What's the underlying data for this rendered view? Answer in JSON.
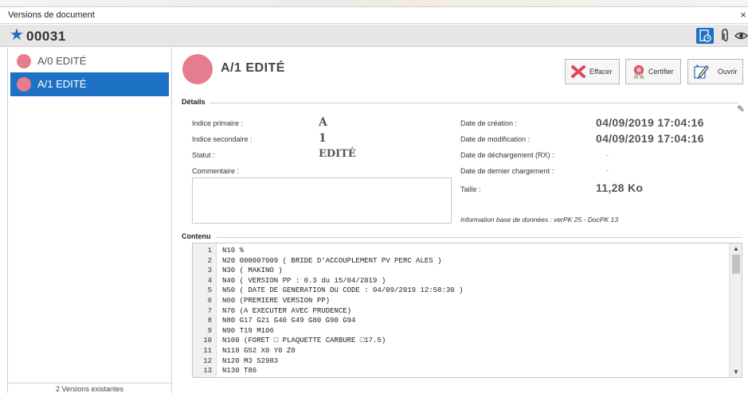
{
  "window": {
    "title": "Versions de document",
    "close_glyph": "×"
  },
  "document": {
    "star_glyph": "★",
    "number": "00031"
  },
  "toolbar": {
    "icons": [
      "history-icon",
      "paperclip-icon",
      "eye-icon"
    ],
    "accent": "#1f6fc5"
  },
  "versions": [
    {
      "label": "A/0  EDITÉ",
      "selected": false,
      "color": "#e47e8f"
    },
    {
      "label": "A/1  EDITÉ",
      "selected": true,
      "color": "#e47e8f"
    }
  ],
  "versions_count": "2 Versions existantes",
  "selected_version": {
    "title": "A/1 EDITÉ",
    "color": "#e47e8f"
  },
  "buttons": {
    "effacer": "Effacer",
    "certifier": "Certifier",
    "ouvrir": "Ouvrir"
  },
  "details": {
    "header": "Détails",
    "indice_primaire_label": "Indice primaire :",
    "indice_primaire_value": "A",
    "indice_secondaire_label": "Indice secondaire :",
    "indice_secondaire_value": "1",
    "statut_label": "Statut :",
    "statut_value": "EDITÉ",
    "commentaire_label": "Commentaire :",
    "date_creation_label": "Date de création :",
    "date_creation_value": "04/09/2019 17:04:16",
    "date_modification_label": "Date de modification :",
    "date_modification_value": "04/09/2019 17:04:16",
    "date_dechargement_label": "Date de déchargement (RX) :",
    "date_dechargement_value": "-",
    "date_chargement_label": "Date de dernier chargement :",
    "date_chargement_value": "-",
    "taille_label": "Taille :",
    "taille_value": "11,28 Ko",
    "db_info": "Information base de données :  verPK 25 - DocPK 13"
  },
  "contenu": {
    "header": "Contenu",
    "lines": [
      {
        "n": "1",
        "text": "N10 %"
      },
      {
        "n": "2",
        "text": "N20 000007009 ( BRIDE D'ACCOUPLEMENT PV PERC ALES )"
      },
      {
        "n": "3",
        "text": "N30 ( MAKINO )"
      },
      {
        "n": "4",
        "text": "N40 ( VERSION PP : 0.3 du 15/04/2019 )"
      },
      {
        "n": "5",
        "text": "N50 ( DATE DE GENERATION DU CODE : 04/09/2019 12:58:30 )"
      },
      {
        "n": "6",
        "text": "N60 (PREMIERE VERSION PP)"
      },
      {
        "n": "7",
        "text": "N70 (A EXECUTER AVEC PRUDENCE)"
      },
      {
        "n": "8",
        "text": "N80 G17 G21 G40 G49 G80 G90 G94"
      },
      {
        "n": "9",
        "text": "N90 T19 M106"
      },
      {
        "n": "10",
        "text": "N100 (FORET □ PLAQUETTE CARBURE □17.5)"
      },
      {
        "n": "11",
        "text": "N110 G52 X0 Y0 Z0"
      },
      {
        "n": "12",
        "text": "N120 M3 S2983"
      },
      {
        "n": "13",
        "text": "N130 T86"
      }
    ]
  }
}
